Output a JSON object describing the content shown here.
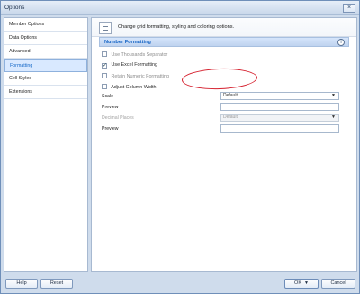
{
  "window": {
    "title": "Options",
    "close_label": "×"
  },
  "sidebar": {
    "items": [
      {
        "label": "Member Options"
      },
      {
        "label": "Data Options"
      },
      {
        "label": "Advanced"
      },
      {
        "label": "Formatting",
        "active": true
      },
      {
        "label": "Cell Styles"
      },
      {
        "label": "Extensions"
      }
    ]
  },
  "header": {
    "description": "Change grid formatting, styling and coloring options."
  },
  "section": {
    "title": "Number Formatting",
    "info_label": "i"
  },
  "checkboxes": {
    "use_thousands_separator": {
      "label": "Use Thousands Separator",
      "checked": false
    },
    "use_excel_formatting": {
      "label": "Use Excel Formatting",
      "checked": true,
      "check_mark": "✓"
    },
    "retain_numeric_formatting": {
      "label": "Retain Numeric Formatting",
      "checked": false
    },
    "adjust_column_width": {
      "label": "Adjust Column Width",
      "checked": false
    }
  },
  "fields": {
    "scale": {
      "label": "Scale",
      "value": "Default",
      "arrow": "▼"
    },
    "scale_preview": {
      "label": "Preview",
      "value": ""
    },
    "decimal_places": {
      "label": "Decimal Places",
      "value": "Default",
      "arrow": "▼"
    },
    "decimal_preview": {
      "label": "Preview",
      "value": ""
    }
  },
  "footer": {
    "help_label": "Help",
    "reset_label": "Reset",
    "ok_label": "OK",
    "cancel_label": "Cancel",
    "ok_arrow": "▼"
  },
  "colors": {
    "accent": "#1669c8",
    "highlight": "#d51f2d"
  },
  "icons": {
    "header": "document-lines-icon",
    "info": "info-icon",
    "close": "close-icon"
  }
}
